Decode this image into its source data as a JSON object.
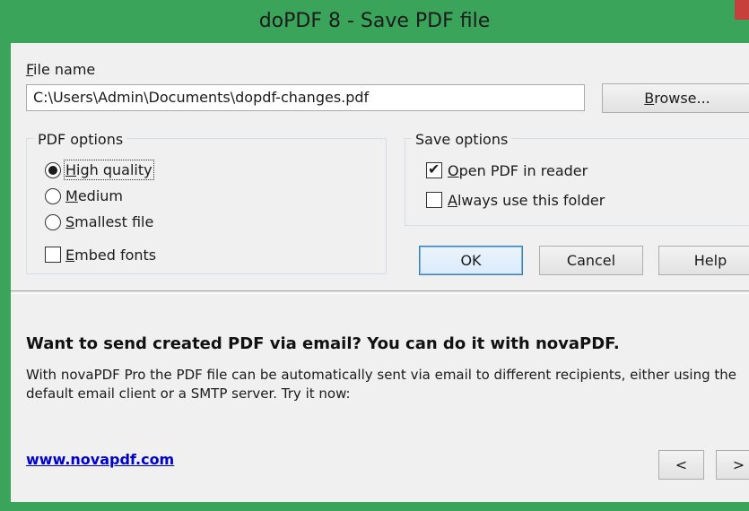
{
  "window": {
    "title": "doPDF 8 - Save PDF file",
    "accent_color": "#3aa55a",
    "close_color": "#c7403c"
  },
  "file_name": {
    "label": "File name",
    "value": "C:\\Users\\Admin\\Documents\\dopdf-changes.pdf",
    "browse_label": "Browse..."
  },
  "pdf_options": {
    "title": "PDF options",
    "options": [
      {
        "label": "High quality",
        "selected": true
      },
      {
        "label": "Medium",
        "selected": false
      },
      {
        "label": "Smallest file",
        "selected": false
      }
    ],
    "embed_fonts": {
      "label": "Embed fonts",
      "checked": false
    }
  },
  "save_options": {
    "title": "Save options",
    "open_in_reader": {
      "label": "Open PDF in reader",
      "checked": true
    },
    "always_use_folder": {
      "label": "Always use this folder",
      "checked": false
    }
  },
  "buttons": {
    "ok": "OK",
    "cancel": "Cancel",
    "help": "Help"
  },
  "promo": {
    "title": "Want to send created PDF via email? You can do it with novaPDF.",
    "text": "With novaPDF Pro the PDF file can be automatically sent via email to different recipients, either using the default email client or a SMTP server. Try it now:",
    "link": "www.novapdf.com",
    "prev_label": "<",
    "next_label": ">"
  }
}
